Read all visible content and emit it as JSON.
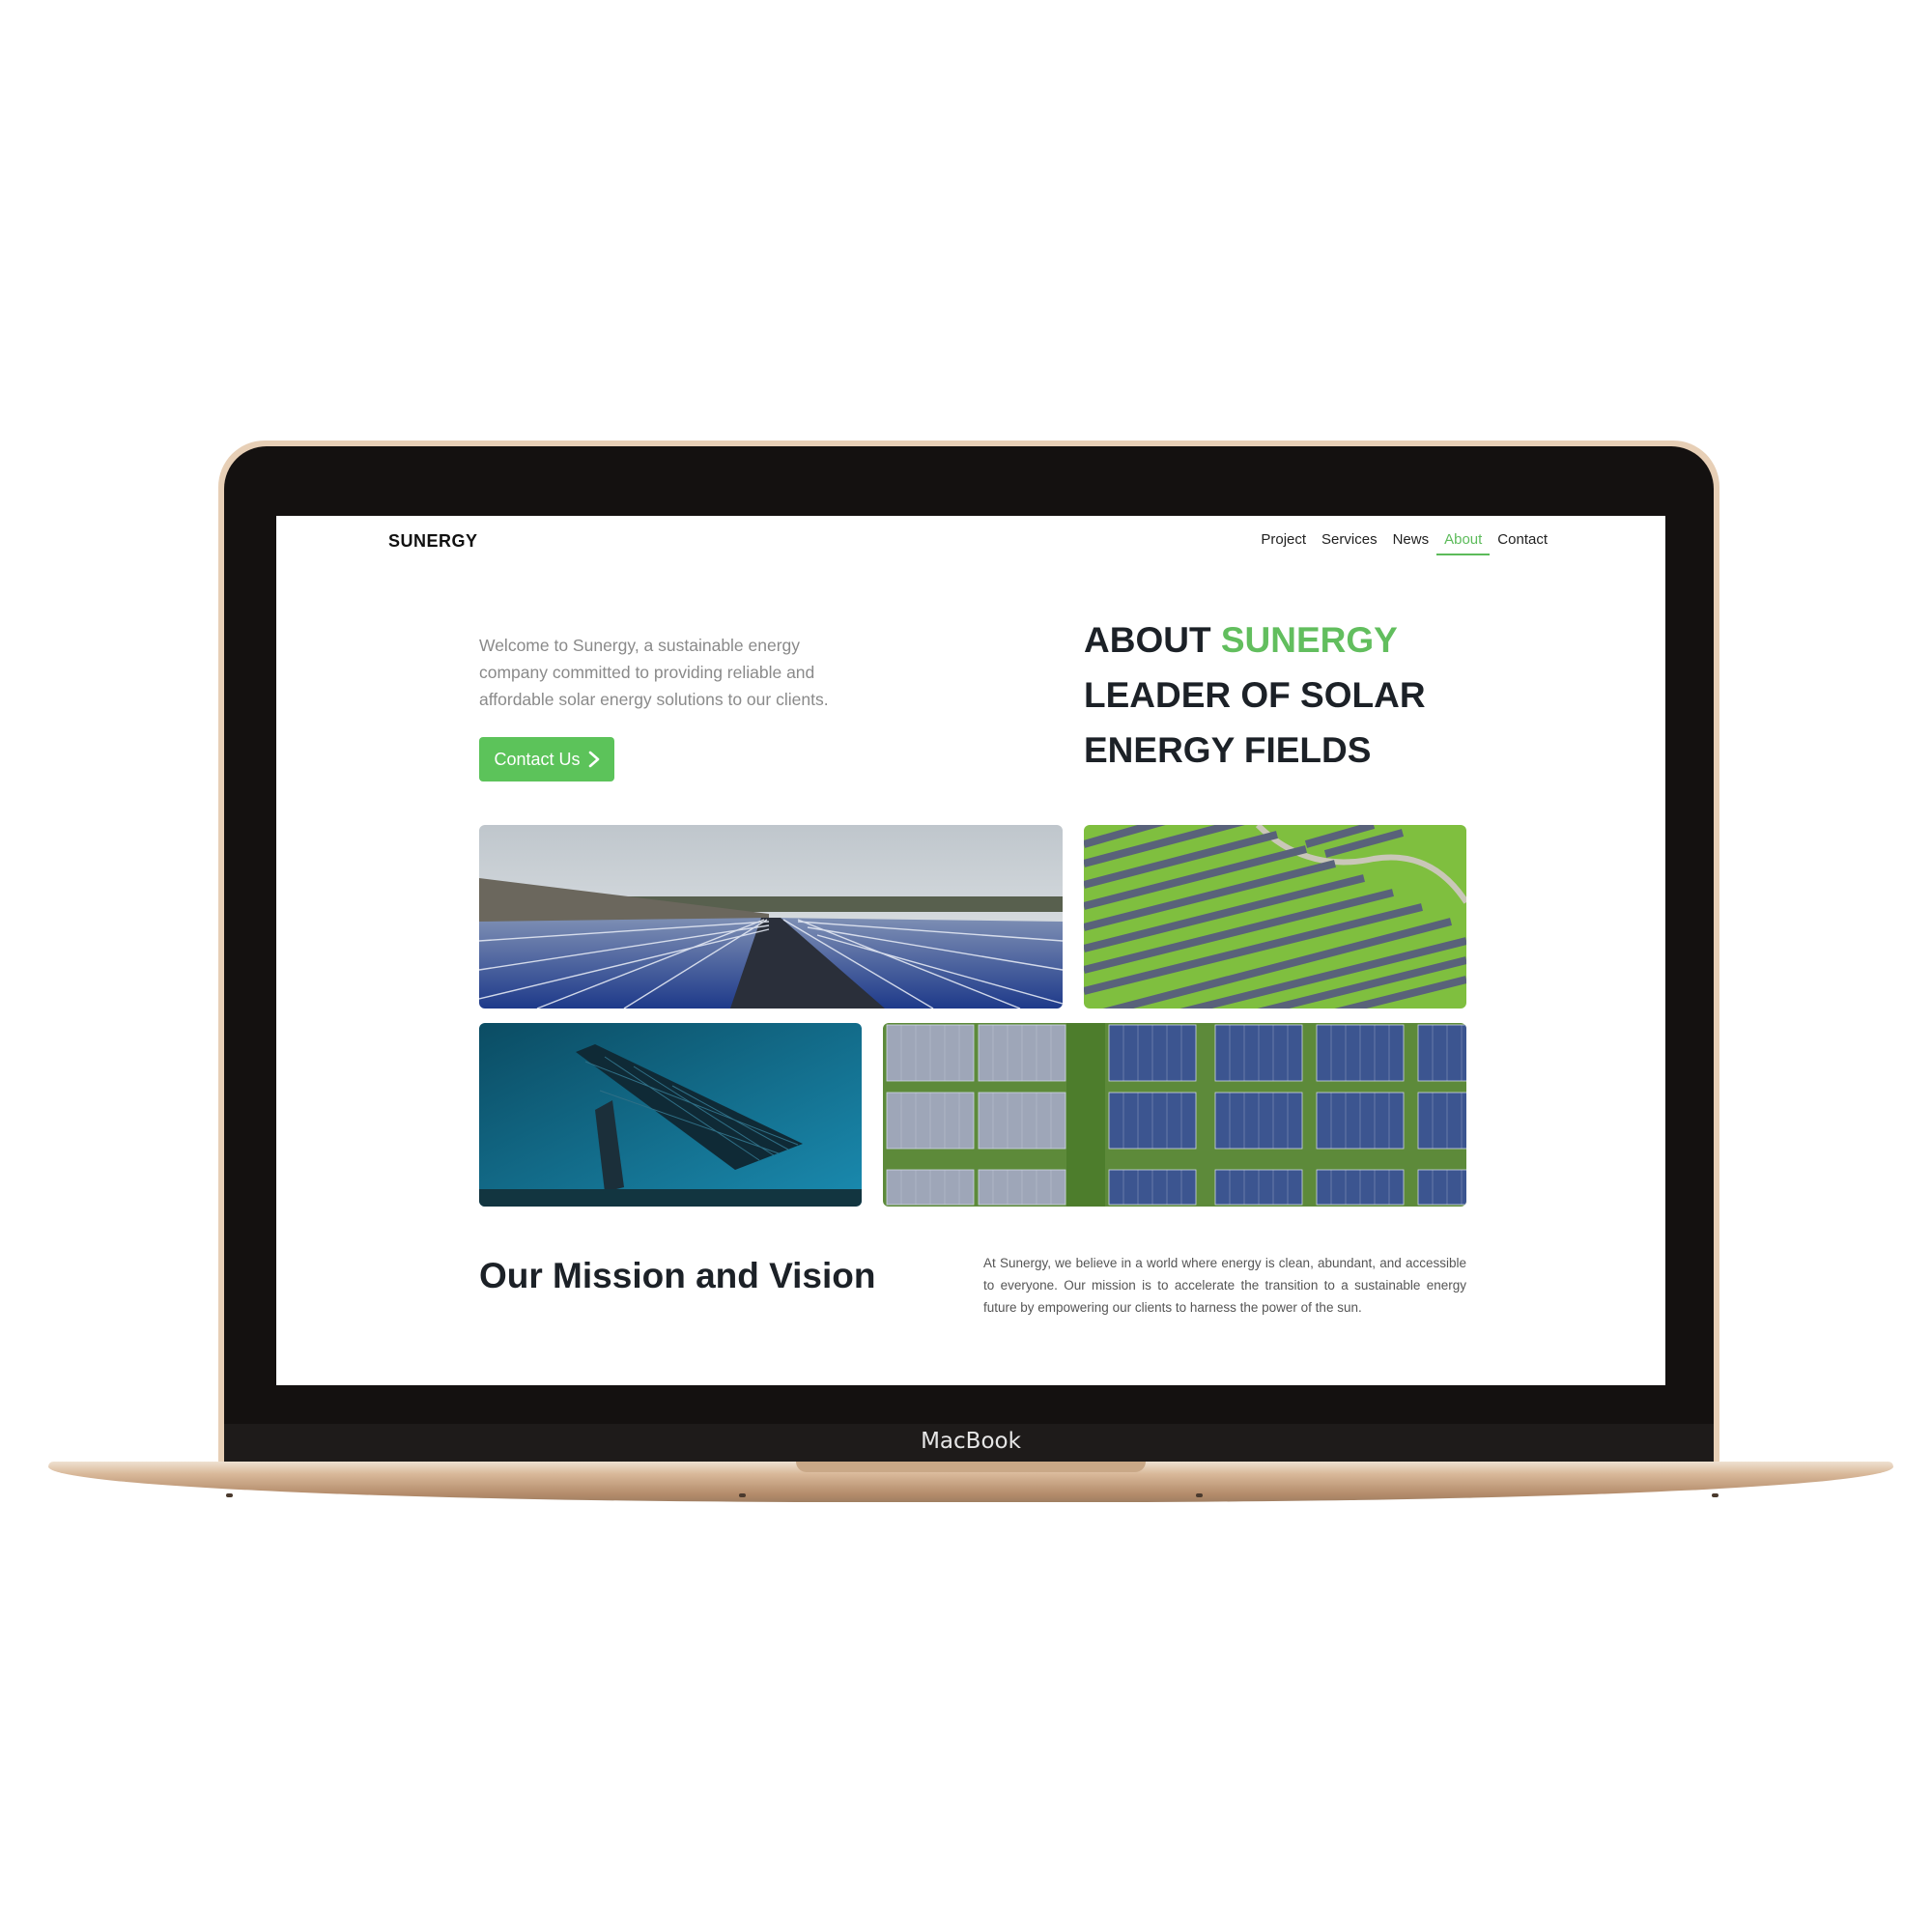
{
  "device": {
    "label": "MacBook"
  },
  "site": {
    "logo": "SUNERGY",
    "nav": [
      {
        "label": "Project"
      },
      {
        "label": "Services"
      },
      {
        "label": "News"
      },
      {
        "label": "About",
        "active": true
      },
      {
        "label": "Contact"
      }
    ]
  },
  "hero": {
    "intro": "Welcome to Sunergy, a sustainable energy company committed to providing reliable and affordable solar energy solutions to our clients.",
    "cta_label": "Contact Us",
    "title_prefix": "ABOUT",
    "title_accent": "SUNERGY",
    "title_line2": "LEADER OF SOLAR",
    "title_line3": "ENERGY FIELDS"
  },
  "gallery": [
    {
      "subject": "rooftop solar panels with city skyline"
    },
    {
      "subject": "aerial view of solar farm rows on green field"
    },
    {
      "subject": "solar canopy against blue sky"
    },
    {
      "subject": "top-down grid of solar panels and grass"
    }
  ],
  "mission": {
    "title": "Our Mission and Vision",
    "text": "At Sunergy, we believe in a world where energy is clean, abundant, and accessible to everyone. Our mission is to accelerate the transition to a sustainable energy future by empowering our clients to harness the power of the sun."
  },
  "colors": {
    "accent": "#5cc35a",
    "heading": "#1c2127",
    "bezel": "#141110",
    "laptop_body": "#e7cfb6"
  },
  "icons": {
    "cta": "chevron-right-icon"
  }
}
